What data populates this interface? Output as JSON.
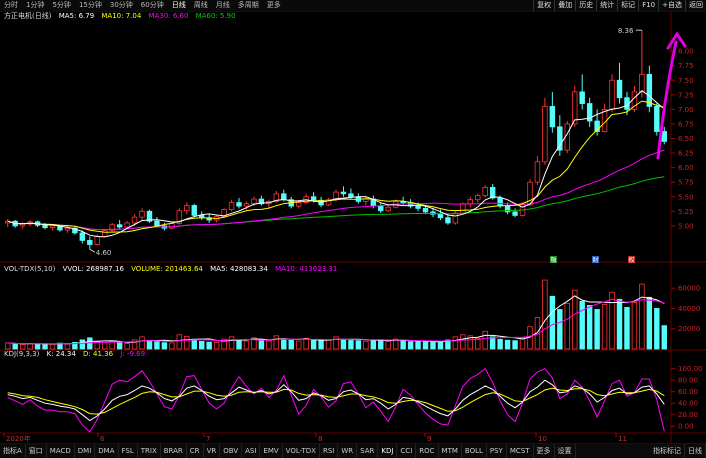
{
  "timeframes": [
    "分时",
    "1分钟",
    "5分钟",
    "15分钟",
    "30分钟",
    "60分钟",
    "日线",
    "周线",
    "月线",
    "多周期",
    "更多"
  ],
  "active_timeframe": "日线",
  "top_right": [
    "复权",
    "叠加",
    "历史",
    "统计",
    "标记",
    "F10",
    "+自选",
    "返回"
  ],
  "main": {
    "stock_label": "方正电机(日线)",
    "ma5": "MA5: 6.79",
    "ma10": "MA10: 7.04",
    "ma30": "MA30: 6.60",
    "ma60": "MA60: 5.90",
    "high_label": "8.36",
    "low_label": "4.60",
    "badges": [
      "融",
      "财",
      "权"
    ],
    "price_ticks": [
      "8.00",
      "7.75",
      "7.50",
      "7.25",
      "7.00",
      "6.75",
      "6.50",
      "6.25",
      "6.00",
      "5.75",
      "5.50",
      "5.25",
      "5.00"
    ]
  },
  "volume": {
    "label": "VOL-TDX(5,10)",
    "vvol": "VVOL: 268987.16",
    "volume": "VOLUME: 201463.64",
    "ma5": "MA5: 428083.34",
    "ma10": "MA10: 413023.31",
    "ticks": [
      "60000",
      "40000",
      "20000"
    ]
  },
  "kdj": {
    "label": "KDJ(9,3,3)",
    "k": "K: 24.34",
    "d": "D: 41.36",
    "j": "J: -9.69",
    "ticks": [
      "100.00",
      "80.00",
      "60.00",
      "40.00",
      "20.00",
      "0.00"
    ]
  },
  "date_axis": [
    "2020年",
    "6",
    "7",
    "8",
    "9",
    "10",
    "11"
  ],
  "bottom_tabs": [
    "指标A",
    "窗口",
    "MACD",
    "DMI",
    "DMA",
    "FSL",
    "TRIX",
    "BRAR",
    "CR",
    "VR",
    "OBV",
    "ASI",
    "EMV",
    "VOL-TDX",
    "RSI",
    "WR",
    "SAR",
    "KDJ",
    "CCI",
    "ROC",
    "MTM",
    "BOLL",
    "PSY",
    "MCST",
    "更多",
    "设置"
  ],
  "bottom_right": [
    "指标标记",
    "日线"
  ],
  "colors": {
    "up": "#ff3232",
    "down": "#54fcfc",
    "ma5": "#ffffff",
    "ma10": "#ffff00",
    "ma30": "#ff00ff",
    "ma60": "#00c000",
    "annotation": "#e000e0"
  },
  "chart_data": {
    "type": "candlestick",
    "ylim": [
      4.5,
      8.5
    ],
    "ohlc": [
      [
        5.05,
        5.12,
        4.98,
        5.08
      ],
      [
        5.08,
        5.1,
        4.97,
        5.0
      ],
      [
        5.0,
        5.06,
        4.95,
        5.03
      ],
      [
        5.03,
        5.1,
        4.99,
        5.07
      ],
      [
        5.07,
        5.09,
        4.98,
        5.01
      ],
      [
        5.01,
        5.05,
        4.94,
        4.97
      ],
      [
        4.97,
        5.03,
        4.92,
        5.0
      ],
      [
        5.0,
        5.02,
        4.9,
        4.93
      ],
      [
        4.93,
        4.99,
        4.88,
        4.96
      ],
      [
        4.96,
        4.98,
        4.85,
        4.88
      ],
      [
        4.88,
        4.92,
        4.7,
        4.75
      ],
      [
        4.75,
        4.82,
        4.6,
        4.68
      ],
      [
        4.68,
        4.85,
        4.66,
        4.82
      ],
      [
        4.82,
        4.95,
        4.8,
        4.92
      ],
      [
        4.92,
        5.05,
        4.9,
        5.02
      ],
      [
        5.02,
        5.1,
        4.95,
        4.98
      ],
      [
        4.98,
        5.08,
        4.96,
        5.05
      ],
      [
        5.05,
        5.2,
        5.0,
        5.15
      ],
      [
        5.15,
        5.3,
        5.1,
        5.25
      ],
      [
        5.25,
        5.28,
        5.05,
        5.08
      ],
      [
        5.08,
        5.15,
        4.98,
        5.0
      ],
      [
        5.0,
        5.05,
        4.92,
        4.96
      ],
      [
        4.96,
        5.06,
        4.94,
        5.04
      ],
      [
        5.04,
        5.3,
        5.02,
        5.26
      ],
      [
        5.26,
        5.4,
        5.2,
        5.35
      ],
      [
        5.35,
        5.38,
        5.15,
        5.18
      ],
      [
        5.18,
        5.25,
        5.1,
        5.14
      ],
      [
        5.14,
        5.2,
        5.05,
        5.1
      ],
      [
        5.1,
        5.18,
        5.06,
        5.16
      ],
      [
        5.16,
        5.3,
        5.14,
        5.28
      ],
      [
        5.28,
        5.45,
        5.25,
        5.4
      ],
      [
        5.4,
        5.48,
        5.3,
        5.34
      ],
      [
        5.34,
        5.42,
        5.28,
        5.38
      ],
      [
        5.38,
        5.5,
        5.34,
        5.46
      ],
      [
        5.46,
        5.52,
        5.35,
        5.38
      ],
      [
        5.38,
        5.45,
        5.3,
        5.42
      ],
      [
        5.42,
        5.6,
        5.4,
        5.55
      ],
      [
        5.55,
        5.62,
        5.42,
        5.45
      ],
      [
        5.45,
        5.5,
        5.3,
        5.34
      ],
      [
        5.34,
        5.44,
        5.3,
        5.4
      ],
      [
        5.4,
        5.55,
        5.38,
        5.5
      ],
      [
        5.5,
        5.58,
        5.4,
        5.44
      ],
      [
        5.44,
        5.5,
        5.32,
        5.36
      ],
      [
        5.36,
        5.48,
        5.34,
        5.45
      ],
      [
        5.45,
        5.62,
        5.42,
        5.58
      ],
      [
        5.58,
        5.68,
        5.5,
        5.55
      ],
      [
        5.55,
        5.64,
        5.46,
        5.5
      ],
      [
        5.5,
        5.56,
        5.38,
        5.42
      ],
      [
        5.42,
        5.5,
        5.35,
        5.46
      ],
      [
        5.46,
        5.52,
        5.3,
        5.34
      ],
      [
        5.34,
        5.4,
        5.22,
        5.26
      ],
      [
        5.26,
        5.36,
        5.24,
        5.32
      ],
      [
        5.32,
        5.45,
        5.3,
        5.42
      ],
      [
        5.42,
        5.5,
        5.36,
        5.4
      ],
      [
        5.4,
        5.46,
        5.3,
        5.34
      ],
      [
        5.34,
        5.4,
        5.25,
        5.3
      ],
      [
        5.3,
        5.36,
        5.2,
        5.24
      ],
      [
        5.24,
        5.3,
        5.15,
        5.2
      ],
      [
        5.2,
        5.28,
        5.1,
        5.14
      ],
      [
        5.14,
        5.2,
        5.02,
        5.05
      ],
      [
        5.05,
        5.25,
        5.02,
        5.22
      ],
      [
        5.22,
        5.4,
        5.2,
        5.38
      ],
      [
        5.38,
        5.5,
        5.32,
        5.45
      ],
      [
        5.45,
        5.55,
        5.4,
        5.52
      ],
      [
        5.52,
        5.7,
        5.48,
        5.66
      ],
      [
        5.66,
        5.72,
        5.45,
        5.48
      ],
      [
        5.48,
        5.52,
        5.3,
        5.34
      ],
      [
        5.34,
        5.4,
        5.2,
        5.24
      ],
      [
        5.24,
        5.3,
        5.15,
        5.18
      ],
      [
        5.18,
        5.4,
        5.16,
        5.36
      ],
      [
        5.36,
        5.8,
        5.34,
        5.75
      ],
      [
        5.75,
        6.2,
        5.7,
        6.1
      ],
      [
        6.1,
        7.2,
        6.05,
        7.05
      ],
      [
        7.05,
        7.3,
        6.6,
        6.7
      ],
      [
        6.7,
        6.9,
        6.2,
        6.3
      ],
      [
        6.3,
        6.8,
        6.25,
        6.75
      ],
      [
        6.75,
        7.4,
        6.7,
        7.3
      ],
      [
        7.3,
        7.6,
        7.0,
        7.1
      ],
      [
        7.1,
        7.2,
        6.7,
        6.8
      ],
      [
        6.8,
        7.0,
        6.55,
        6.62
      ],
      [
        6.62,
        7.1,
        6.6,
        7.0
      ],
      [
        7.0,
        7.6,
        6.95,
        7.5
      ],
      [
        7.5,
        7.8,
        7.1,
        7.2
      ],
      [
        7.2,
        7.3,
        6.9,
        7.0
      ],
      [
        7.0,
        7.4,
        6.95,
        7.3
      ],
      [
        7.3,
        8.36,
        7.2,
        7.6
      ],
      [
        7.6,
        7.75,
        6.95,
        7.05
      ],
      [
        7.05,
        7.1,
        6.55,
        6.62
      ],
      [
        6.62,
        6.7,
        6.4,
        6.45
      ]
    ],
    "volume_series": [
      [
        6000,
        true
      ],
      [
        5000,
        false
      ],
      [
        4500,
        true
      ],
      [
        5500,
        true
      ],
      [
        4800,
        false
      ],
      [
        5200,
        false
      ],
      [
        4700,
        true
      ],
      [
        5800,
        false
      ],
      [
        5000,
        true
      ],
      [
        6500,
        false
      ],
      [
        9000,
        false
      ],
      [
        11000,
        false
      ],
      [
        7000,
        true
      ],
      [
        6500,
        true
      ],
      [
        7200,
        true
      ],
      [
        6000,
        false
      ],
      [
        5500,
        true
      ],
      [
        9000,
        true
      ],
      [
        12000,
        true
      ],
      [
        8500,
        false
      ],
      [
        7000,
        false
      ],
      [
        6200,
        false
      ],
      [
        6000,
        true
      ],
      [
        14000,
        true
      ],
      [
        12500,
        true
      ],
      [
        9000,
        false
      ],
      [
        7500,
        false
      ],
      [
        6800,
        false
      ],
      [
        6500,
        true
      ],
      [
        9800,
        true
      ],
      [
        12000,
        true
      ],
      [
        8800,
        false
      ],
      [
        7800,
        true
      ],
      [
        11000,
        true
      ],
      [
        9000,
        false
      ],
      [
        8000,
        true
      ],
      [
        13000,
        true
      ],
      [
        9800,
        false
      ],
      [
        8600,
        false
      ],
      [
        7800,
        true
      ],
      [
        10500,
        true
      ],
      [
        8800,
        false
      ],
      [
        8200,
        false
      ],
      [
        8800,
        true
      ],
      [
        12000,
        true
      ],
      [
        9500,
        false
      ],
      [
        9200,
        false
      ],
      [
        8200,
        false
      ],
      [
        7600,
        true
      ],
      [
        8800,
        false
      ],
      [
        9200,
        false
      ],
      [
        7400,
        true
      ],
      [
        9800,
        true
      ],
      [
        8000,
        false
      ],
      [
        7200,
        false
      ],
      [
        7000,
        false
      ],
      [
        7600,
        false
      ],
      [
        6800,
        false
      ],
      [
        7200,
        false
      ],
      [
        8800,
        false
      ],
      [
        12000,
        true
      ],
      [
        14000,
        true
      ],
      [
        13000,
        true
      ],
      [
        10500,
        true
      ],
      [
        17500,
        true
      ],
      [
        12000,
        false
      ],
      [
        9500,
        false
      ],
      [
        8600,
        false
      ],
      [
        8200,
        false
      ],
      [
        11000,
        true
      ],
      [
        22000,
        true
      ],
      [
        31000,
        true
      ],
      [
        68000,
        true
      ],
      [
        52000,
        false
      ],
      [
        39000,
        false
      ],
      [
        45000,
        true
      ],
      [
        58000,
        true
      ],
      [
        47000,
        false
      ],
      [
        43000,
        false
      ],
      [
        39000,
        false
      ],
      [
        44000,
        true
      ],
      [
        56000,
        true
      ],
      [
        49000,
        false
      ],
      [
        41000,
        false
      ],
      [
        46000,
        true
      ],
      [
        64000,
        true
      ],
      [
        51000,
        false
      ],
      [
        40000,
        false
      ],
      [
        23000,
        false
      ]
    ],
    "kdj_lines": {
      "k": [
        55,
        52,
        48,
        50,
        45,
        40,
        38,
        35,
        33,
        30,
        20,
        10,
        18,
        30,
        45,
        52,
        55,
        62,
        70,
        66,
        58,
        48,
        44,
        52,
        66,
        70,
        62,
        52,
        46,
        48,
        58,
        68,
        63,
        58,
        62,
        56,
        60,
        72,
        60,
        45,
        48,
        58,
        53,
        45,
        48,
        60,
        63,
        56,
        46,
        48,
        40,
        30,
        38,
        50,
        48,
        42,
        35,
        28,
        22,
        18,
        30,
        45,
        55,
        62,
        70,
        64,
        52,
        40,
        32,
        42,
        60,
        68,
        80,
        72,
        58,
        60,
        70,
        66,
        56,
        42,
        50,
        62,
        66,
        56,
        58,
        68,
        70,
        56,
        38
      ],
      "d": [
        58,
        56,
        53,
        52,
        50,
        46,
        43,
        40,
        37,
        34,
        29,
        22,
        21,
        24,
        31,
        38,
        44,
        50,
        57,
        60,
        59,
        55,
        51,
        51,
        56,
        61,
        61,
        58,
        54,
        52,
        54,
        59,
        60,
        59,
        60,
        59,
        59,
        64,
        63,
        57,
        54,
        55,
        54,
        51,
        50,
        53,
        56,
        56,
        53,
        51,
        47,
        41,
        40,
        43,
        45,
        44,
        41,
        36,
        31,
        26,
        27,
        33,
        41,
        48,
        55,
        58,
        56,
        50,
        44,
        43,
        49,
        55,
        63,
        66,
        63,
        62,
        65,
        65,
        62,
        55,
        53,
        56,
        59,
        58,
        58,
        61,
        64,
        61,
        53
      ],
      "j": [
        50,
        44,
        38,
        46,
        35,
        28,
        28,
        25,
        25,
        22,
        2,
        -10,
        12,
        42,
        73,
        80,
        77,
        86,
        96,
        78,
        56,
        34,
        30,
        54,
        86,
        88,
        64,
        40,
        30,
        40,
        66,
        86,
        69,
        56,
        66,
        50,
        62,
        88,
        54,
        21,
        36,
        64,
        51,
        33,
        44,
        74,
        77,
        56,
        32,
        42,
        26,
        8,
        34,
        64,
        54,
        38,
        23,
        12,
        4,
        2,
        36,
        69,
        83,
        90,
        100,
        76,
        44,
        20,
        8,
        40,
        82,
        94,
        100,
        84,
        48,
        56,
        80,
        68,
        44,
        16,
        44,
        74,
        80,
        52,
        58,
        82,
        82,
        46,
        -9
      ]
    }
  }
}
